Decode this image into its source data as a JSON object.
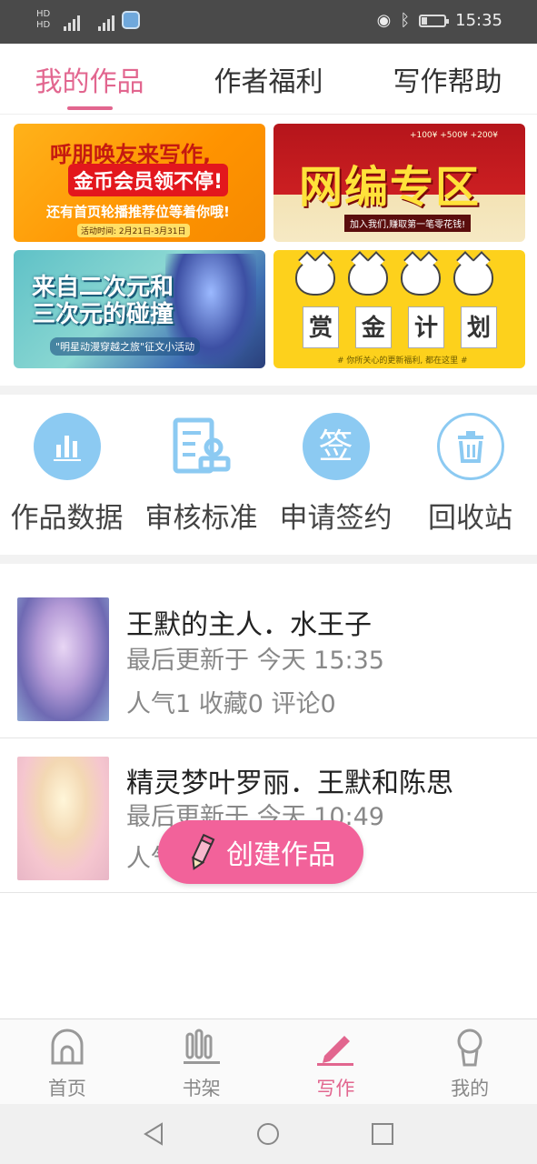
{
  "status_bar": {
    "sim1": "HD 4G",
    "sim2": "4G",
    "time": "15:35"
  },
  "top_tabs": [
    {
      "label": "我的作品",
      "active": true
    },
    {
      "label": "作者福利",
      "active": false
    },
    {
      "label": "写作帮助",
      "active": false
    }
  ],
  "banners": {
    "b1": {
      "line1": "呼朋唤友来写作,",
      "line2": "金币会员领不停!",
      "line3": "还有首页轮播推荐位等着你哦!",
      "line4": "活动时间: 2月21日-3月31日"
    },
    "b2": {
      "title": "网编专区",
      "subtitle": "加入我们,赚取第一笔零花钱!",
      "coins": "+100¥  +500¥  +200¥"
    },
    "b3": {
      "title_line1": "来自二次元和",
      "title_line2": "三次元的碰撞",
      "footer": "\"明星动漫穿越之旅\"征文小活动"
    },
    "b4": {
      "words": [
        "赏",
        "金",
        "计",
        "划"
      ],
      "note": "# 你所关心的更新福利, 都在这里 #"
    }
  },
  "tools": [
    {
      "label": "作品数据",
      "icon": "bar-chart-icon",
      "color": "#8ccaf2"
    },
    {
      "label": "审核标准",
      "icon": "review-stamp-icon",
      "color": "#8ccaf2"
    },
    {
      "label": "申请签约",
      "icon": "sign-icon",
      "color": "#8ccaf2"
    },
    {
      "label": "回收站",
      "icon": "trash-icon",
      "color": "#8ccaf2"
    }
  ],
  "works": [
    {
      "title": "王默的主人．水王子",
      "updated": "最后更新于 今天 15:35",
      "stats": "人气1 收藏0 评论0"
    },
    {
      "title": "精灵梦叶罗丽．王默和陈思",
      "updated": "最后更新于 今天 10:49",
      "stats": "人气1 收藏0 评论0"
    }
  ],
  "create_button": {
    "label": "创建作品"
  },
  "bottom_nav": [
    {
      "label": "首页",
      "icon": "home-icon",
      "active": false
    },
    {
      "label": "书架",
      "icon": "bookshelf-icon",
      "active": false
    },
    {
      "label": "写作",
      "icon": "pen-icon",
      "active": true
    },
    {
      "label": "我的",
      "icon": "profile-icon",
      "active": false
    }
  ],
  "colors": {
    "accent": "#e2668f",
    "create_button": "#f2629a",
    "tool_icon": "#8ccaf2"
  }
}
